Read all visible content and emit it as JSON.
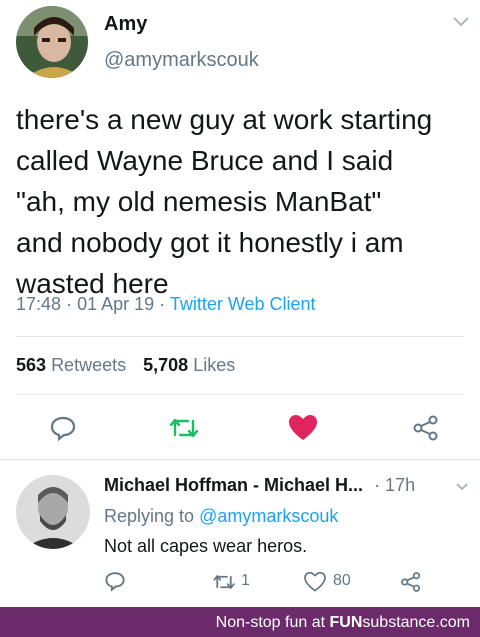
{
  "tweet": {
    "display_name": "Amy",
    "handle": "@amymarkscouk",
    "text_lines": [
      "there's a new guy at work starting",
      "called Wayne Bruce and I said",
      "\"ah, my old nemesis ManBat\"",
      "and nobody got it honestly i am",
      "wasted here"
    ],
    "time": "17:48",
    "date": "01 Apr 19",
    "separator": "·",
    "client": "Twitter Web Client",
    "retweets_count": "563",
    "retweets_label": "Retweets",
    "likes_count": "5,708",
    "likes_label": "Likes"
  },
  "reply": {
    "display_name": "Michael Hoffman - Michael H...",
    "time_ago": "· 17h",
    "replying_prefix": "Replying to",
    "replying_handle": "@amymarkscouk",
    "text": "Not all capes wear heros.",
    "retweet_count": "1",
    "like_count": "80"
  },
  "footer": {
    "prefix": "Non-stop fun at ",
    "brand": "FUN",
    "suffix": "substance.com"
  },
  "colors": {
    "like_red": "#e0245e",
    "retweet_green": "#17bf63",
    "link_blue": "#1da1f2",
    "muted_gray": "#657786",
    "footer_purple": "#6b2b6b"
  }
}
